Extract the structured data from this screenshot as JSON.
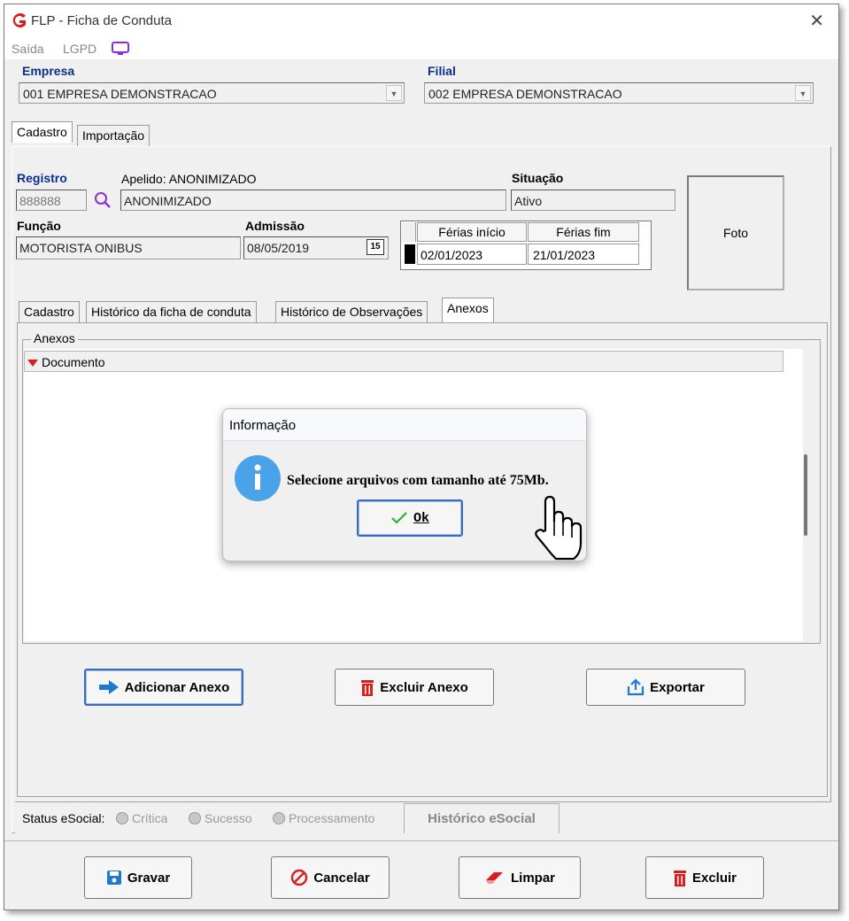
{
  "window": {
    "title": "FLP - Ficha de Conduta",
    "close_glyph": "✕"
  },
  "menu": {
    "saida": "Saída",
    "lgpd": "LGPD"
  },
  "empresa": {
    "label": "Empresa",
    "value": "001 EMPRESA DEMONSTRACAO"
  },
  "filial": {
    "label": "Filial",
    "value": "002 EMPRESA DEMONSTRACAO"
  },
  "top_tabs": [
    "Cadastro",
    "Importação"
  ],
  "registro": {
    "label": "Registro",
    "value": "888888"
  },
  "apelido": {
    "label": "Apelido: ANONIMIZADO",
    "value": "ANONIMIZADO"
  },
  "situacao": {
    "label": "Situação",
    "value": "Ativo"
  },
  "funcao": {
    "label": "Função",
    "value": "MOTORISTA ONIBUS"
  },
  "admissao": {
    "label": "Admissão",
    "value": "08/05/2019",
    "calendar_glyph": "15"
  },
  "ferias": {
    "headers": [
      "Férias início",
      "Férias fim"
    ],
    "rows": [
      [
        "02/01/2023",
        "21/01/2023"
      ]
    ]
  },
  "foto": {
    "label": "Foto"
  },
  "inner_tabs": [
    "Cadastro",
    "Histórico da ficha de conduta",
    "Histórico de Observações",
    "Anexos"
  ],
  "anexos": {
    "group_label": "Anexos",
    "column_header": "Documento"
  },
  "dialog": {
    "title": "Informação",
    "message": "Selecione arquivos com tamanho até 75Mb.",
    "ok_label": "Ok"
  },
  "attachment_buttons": {
    "add": "Adicionar Anexo",
    "delete": "Excluir Anexo",
    "export": "Exportar"
  },
  "status_bar": {
    "label": "Status eSocial:",
    "options": [
      "Crítica",
      "Sucesso",
      "Processamento"
    ],
    "history_button": "Histórico eSocial"
  },
  "footer_buttons": {
    "save": "Gravar",
    "cancel": "Cancelar",
    "clear": "Limpar",
    "delete": "Excluir"
  },
  "colors": {
    "accent_blue": "#0a2f8a",
    "info_blue": "#4aa3e8",
    "danger_red": "#d81e1e",
    "lgpd_purple": "#8b2fd8"
  }
}
